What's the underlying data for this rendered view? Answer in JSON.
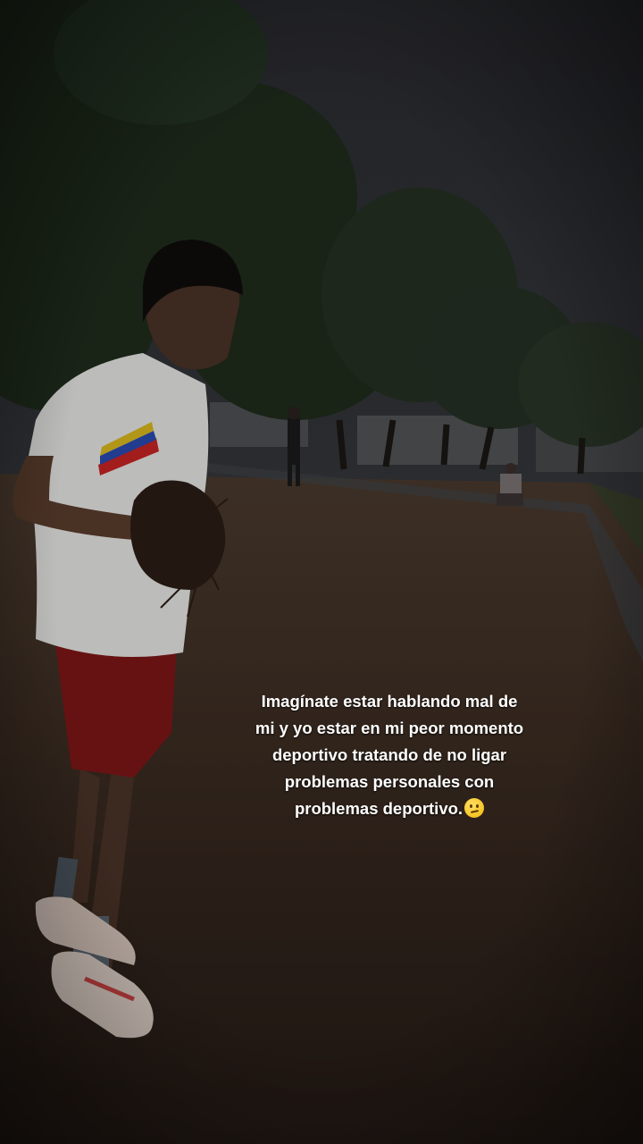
{
  "caption": {
    "lines": [
      "Imagínate estar hablando mal de",
      "mi y yo estar en mi peor momento",
      "deportivo tratando de no ligar",
      "problemas personales con",
      "problemas deportivo."
    ],
    "emoji_name": "confused-face-emoji"
  },
  "scene": {
    "description_icon": "photo-background",
    "colors": {
      "sky": "#2a2b30",
      "trees": "#1e2a1a",
      "ground": "#3a2a20",
      "shirt": "#e9e9e6",
      "shorts": "#8c1a1a"
    }
  }
}
